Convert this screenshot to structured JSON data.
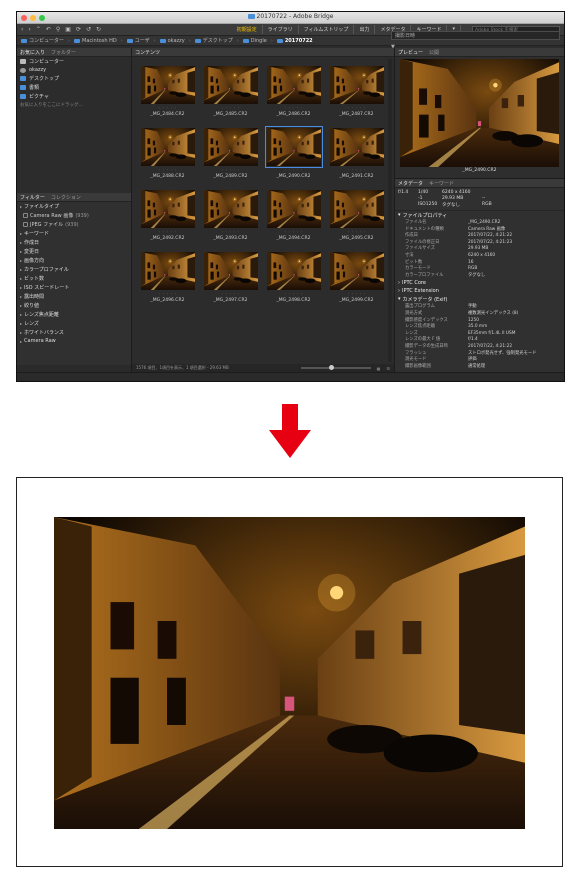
{
  "window": {
    "title": "20170722 - Adobe Bridge",
    "traffic_lights": [
      "#fc605c",
      "#fdbc40",
      "#34c84a"
    ]
  },
  "toolbar": {
    "tools": [
      "‹",
      "›",
      "⌃",
      "↶",
      "⚲",
      "▣",
      "⟳",
      "↺",
      "↻"
    ],
    "workspaces": [
      "初期設定",
      "ライブラリ",
      "フィルムストリップ",
      "出力",
      "メタデータ",
      "キーワード"
    ],
    "workspace_more": "▾",
    "search_placeholder": "Adobe Stock を検索"
  },
  "path": {
    "crumbs": [
      "コンピューター",
      "Macintosh HD",
      "ユーザ",
      "okazzy",
      "デスクトップ",
      "Dingle",
      "20170722"
    ],
    "sort_label": "撮影日時",
    "filter_label": "▼"
  },
  "panels": {
    "favorites_tab": "お気に入り",
    "folders_tab": "フォルダー",
    "content_tab": "コンテンツ",
    "preview_tab": "プレビュー",
    "publish_tab": "公開",
    "filter_tab": "フィルター",
    "collection_tab": "コレクション",
    "metadata_tab": "メタデータ",
    "keyword_tab": "キーワード"
  },
  "favorites": [
    {
      "label": "コンピューター",
      "icon": "disk"
    },
    {
      "label": "okazzy",
      "icon": "user"
    },
    {
      "label": "デスクトップ",
      "icon": "folder"
    },
    {
      "label": "書類",
      "icon": "folder"
    },
    {
      "label": "ピクチャ",
      "icon": "folder"
    }
  ],
  "favorites_hint": "お気に入りをここにドラッグ...",
  "filters": [
    {
      "label": "ファイルタイプ",
      "sub": false
    },
    {
      "label": "Camera Raw 画像",
      "count": "(939)",
      "sub": true
    },
    {
      "label": "JPEG ファイル",
      "count": "(939)",
      "sub": true
    },
    {
      "label": "キーワード",
      "sub": false
    },
    {
      "label": "作成日",
      "sub": false
    },
    {
      "label": "変更日",
      "sub": false
    },
    {
      "label": "画像方向",
      "sub": false
    },
    {
      "label": "カラープロファイル",
      "sub": false
    },
    {
      "label": "ビット数",
      "sub": false
    },
    {
      "label": "ISO スピードレート",
      "sub": false
    },
    {
      "label": "露出時間",
      "sub": false
    },
    {
      "label": "絞り値",
      "sub": false
    },
    {
      "label": "レンズ焦点距離",
      "sub": false
    },
    {
      "label": "レンズ",
      "sub": false
    },
    {
      "label": "ホワイトバランス",
      "sub": false
    },
    {
      "label": "Camera Raw",
      "sub": false
    }
  ],
  "thumbnails": [
    {
      "name": "_MG_2484.CR2"
    },
    {
      "name": "_MG_2485.CR2"
    },
    {
      "name": "_MG_2486.CR2"
    },
    {
      "name": "_MG_2487.CR2"
    },
    {
      "name": "_MG_2488.CR2"
    },
    {
      "name": "_MG_2489.CR2"
    },
    {
      "name": "_MG_2490.CR2",
      "selected": true
    },
    {
      "name": "_MG_2491.CR2"
    },
    {
      "name": "_MG_2492.CR2"
    },
    {
      "name": "_MG_2493.CR2"
    },
    {
      "name": "_MG_2494.CR2"
    },
    {
      "name": "_MG_2495.CR2"
    },
    {
      "name": "_MG_2496.CR2"
    },
    {
      "name": "_MG_2497.CR2"
    },
    {
      "name": "_MG_2498.CR2"
    },
    {
      "name": "_MG_2499.CR2"
    }
  ],
  "thumb_stars": "・・・・・",
  "content_status": "1576 項目、1項目を表示、1 項目選択 - 29.63 MB",
  "preview": {
    "filename": "_MG_2490.CR2"
  },
  "metadata": {
    "quick": [
      "f/1.4",
      "1/40",
      "6240 x 4160",
      "",
      "",
      "-1",
      "29.93 MB",
      "--",
      "",
      "ISO1250",
      "タグなし",
      "RGB"
    ],
    "section_file": "ファイルプロパティ",
    "file_props": [
      [
        "ファイル名",
        "_MG_2490.CR2"
      ],
      [
        "ドキュメントの種類",
        "Camera Raw 画像"
      ],
      [
        "作成日",
        "2017/07/22, 4:21:22"
      ],
      [
        "ファイルの修正日",
        "2017/07/22, 4:21:23"
      ],
      [
        "ファイルサイズ",
        "29.93 MB"
      ],
      [
        "寸法",
        "6240 x 4160"
      ],
      [
        "ビット数",
        "16"
      ],
      [
        "カラーモード",
        "RGB"
      ],
      [
        "カラープロファイル",
        "タグなし"
      ]
    ],
    "section_iptc": "IPTC Core",
    "section_iptc_ext": "IPTC Extension",
    "section_camera": "カメラデータ (Exif)",
    "camera_props": [
      [
        "露出プログラム",
        "手動"
      ],
      [
        "測光方式",
        "複数測光インデックス (8)"
      ],
      [
        "撮影感度インデックス",
        "1250"
      ],
      [
        "レンズ焦点距離",
        "35.0 mm"
      ],
      [
        "レンズ",
        "EF35mm f/1.4L II USM"
      ],
      [
        "レンズの最大 F 値",
        "f/1.4"
      ],
      [
        "撮影データの生成日時",
        "2017/07/22, 4:21:22"
      ],
      [
        "フラッシュ",
        "ストロボ発光せず、強制発光モード"
      ],
      [
        "測光モード",
        "評価"
      ],
      [
        "撮影画像範囲",
        "通常処理"
      ]
    ]
  },
  "arrow_color": "#e60012"
}
